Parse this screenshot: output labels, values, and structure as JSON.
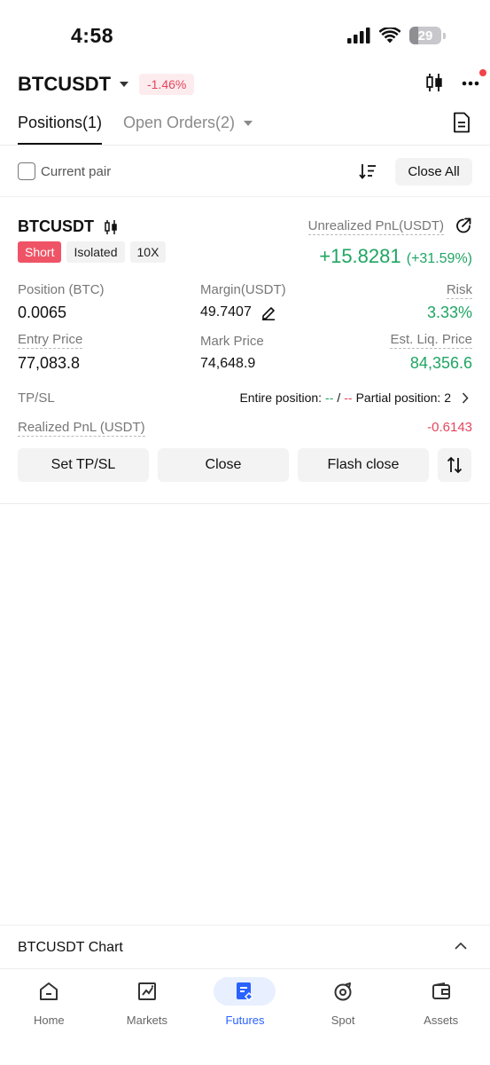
{
  "status_bar": {
    "time": "4:58",
    "battery": "29",
    "battery_level": 0.29
  },
  "header": {
    "symbol": "BTCUSDT",
    "change": "-1.46%"
  },
  "tabs": {
    "positions": "Positions(1)",
    "open_orders": "Open Orders(2)"
  },
  "filter": {
    "current_pair": "Current pair",
    "close_all": "Close All"
  },
  "position": {
    "symbol": "BTCUSDT",
    "side": "Short",
    "margin_mode": "Isolated",
    "leverage": "10X",
    "unrealized_label": "Unrealized PnL(USDT)",
    "unrealized_value": "+15.8281",
    "unrealized_pct": "(+31.59%)",
    "position_label": "Position (BTC)",
    "position_value": "0.0065",
    "margin_label": "Margin(USDT)",
    "margin_value": "49.7407",
    "risk_label": "Risk",
    "risk_value": "3.33%",
    "entry_label": "Entry Price",
    "entry_value": "77,083.8",
    "mark_label": "Mark Price",
    "mark_value": "74,648.9",
    "liq_label": "Est. Liq. Price",
    "liq_value": "84,356.6",
    "tpsl_label": "TP/SL",
    "tpsl_entire": "Entire position:",
    "tpsl_tp": "--",
    "tpsl_sep": "/",
    "tpsl_sl": "--",
    "tpsl_partial": "Partial position: 2",
    "realized_label": "Realized PnL (USDT)",
    "realized_value": "-0.6143",
    "btn_tpsl": "Set TP/SL",
    "btn_close": "Close",
    "btn_flash": "Flash close"
  },
  "chart_bar": {
    "label": "BTCUSDT Chart"
  },
  "nav": {
    "items": [
      {
        "label": "Home",
        "icon": "home-icon"
      },
      {
        "label": "Markets",
        "icon": "markets-icon"
      },
      {
        "label": "Futures",
        "icon": "futures-icon"
      },
      {
        "label": "Spot",
        "icon": "spot-icon"
      },
      {
        "label": "Assets",
        "icon": "wallet-icon"
      }
    ],
    "active_index": 2
  },
  "colors": {
    "positive": "#1fa563",
    "negative": "#e5455d",
    "accent": "#2962ff"
  }
}
